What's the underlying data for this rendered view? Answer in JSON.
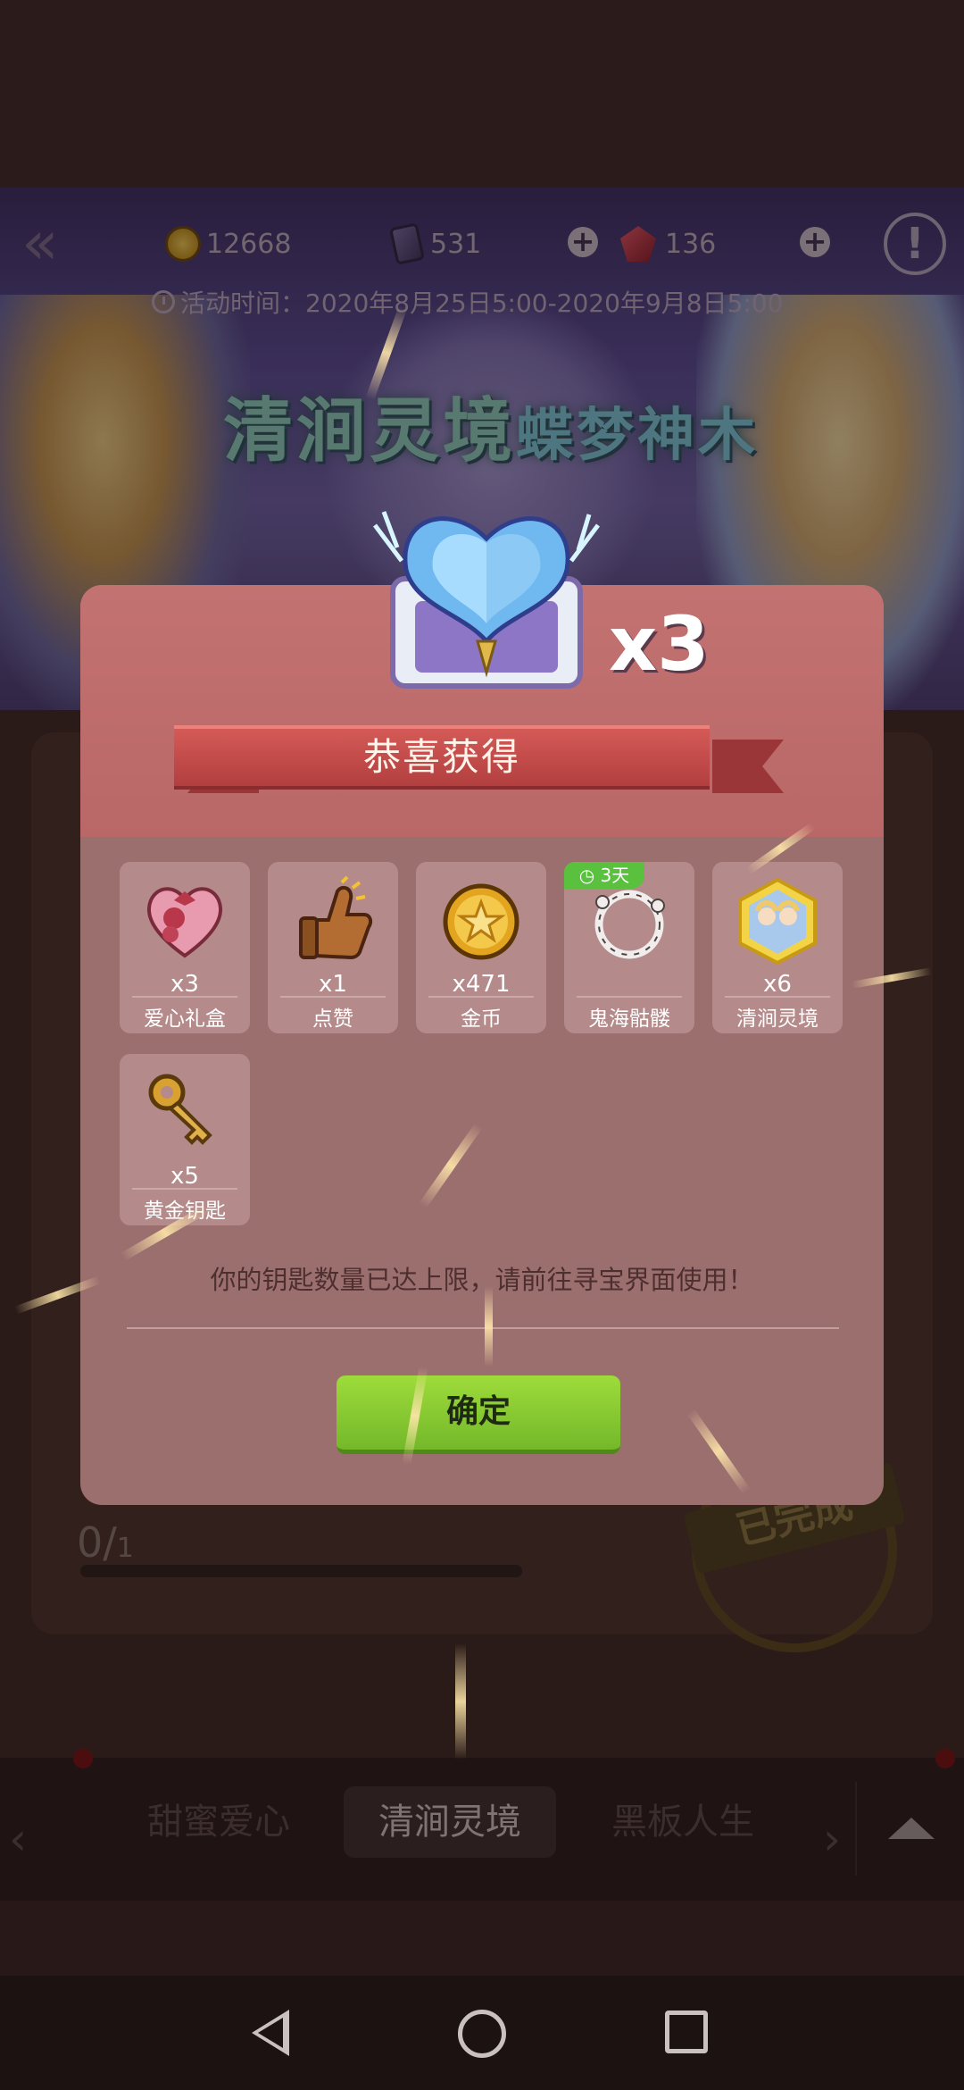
{
  "top_bar": {
    "coins": "12668",
    "cards": "531",
    "gems": "136",
    "event_time": "活动时间：2020年8月25日5:00-2020年9月8日5:00"
  },
  "banner": {
    "title_line1": "清涧灵境",
    "title_line1b": "蝶梦神木"
  },
  "dialog": {
    "chest_count": "x3",
    "header": "恭喜获得",
    "items": [
      {
        "qty": "x3",
        "name": "爱心礼盒",
        "icon": "heart-gift-box-icon"
      },
      {
        "qty": "x1",
        "name": "点赞",
        "icon": "thumbs-up-icon"
      },
      {
        "qty": "x471",
        "name": "金币",
        "icon": "gold-coin-icon"
      },
      {
        "qty": "",
        "name": "鬼海骷髅",
        "icon": "skull-ring-icon",
        "badge": "3天"
      },
      {
        "qty": "x6",
        "name": "清涧灵境",
        "icon": "character-portrait-icon"
      },
      {
        "qty": "x5",
        "name": "黄金钥匙",
        "icon": "golden-key-icon"
      }
    ],
    "message": "你的钥匙数量已达上限，请前往寻宝界面使用！",
    "ok_label": "确定"
  },
  "background": {
    "progress_current": "0/",
    "progress_total": "1",
    "stamp_label": "已完成"
  },
  "tabs": {
    "items": [
      "甜蜜爱心",
      "清涧灵境",
      "黑板人生"
    ],
    "active": "清涧灵境"
  },
  "colors": {
    "dialog_bg": "#9c6f6f",
    "ribbon": "#c94c4a",
    "ok_button": "#86c832"
  }
}
